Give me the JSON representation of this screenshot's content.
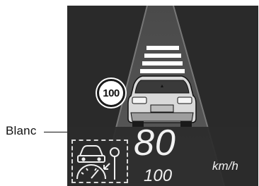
{
  "callout": {
    "label": "Blanc"
  },
  "hud": {
    "speed_limit_sign": "100",
    "current_speed": "80",
    "set_speed": "100",
    "unit": "km/h",
    "icons": [
      "car-assist-icon",
      "speedometer-icon",
      "steering-assist-icon"
    ],
    "colors": {
      "background": "#2b2b2b",
      "text": "#f2f2f2",
      "markings": "#ffffff"
    }
  }
}
